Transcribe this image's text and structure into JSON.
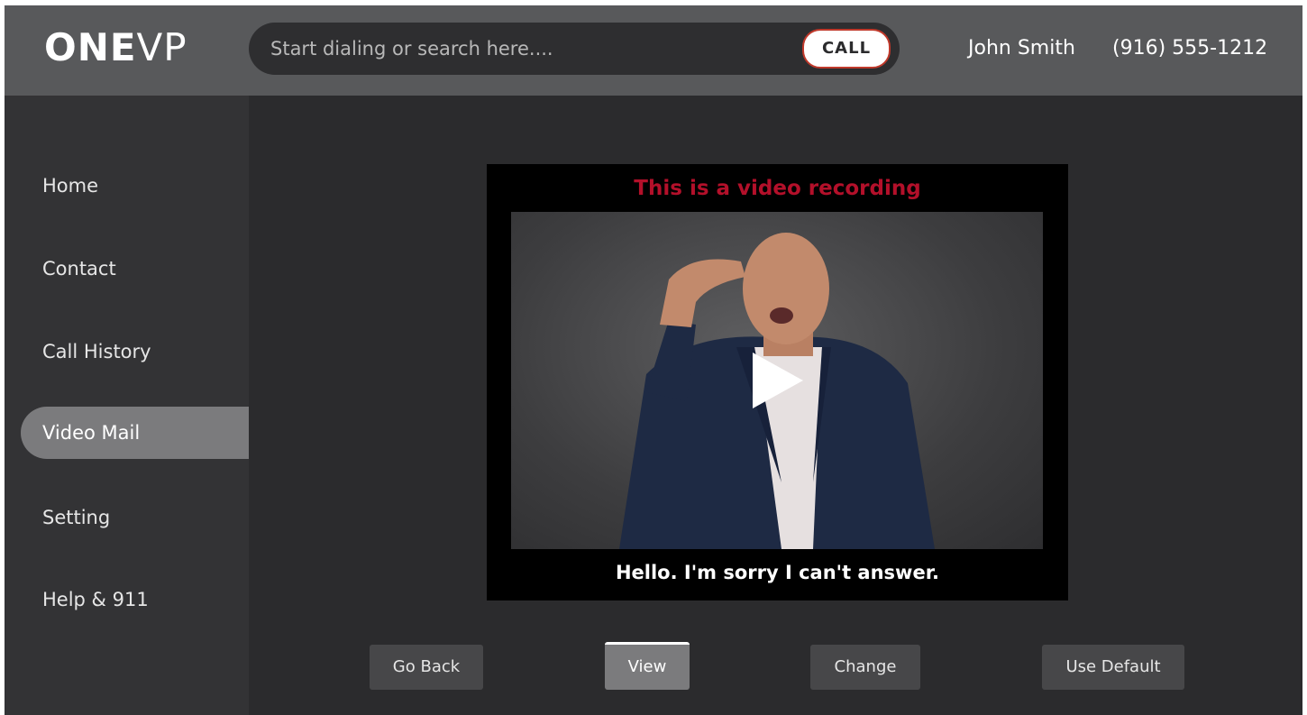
{
  "header": {
    "logo_bold": "ONE",
    "logo_light": "VP",
    "search": {
      "placeholder": "Start dialing or search here....",
      "value": ""
    },
    "call_label": "CALL",
    "user_name": "John Smith",
    "user_phone": "(916) 555-1212"
  },
  "sidebar": {
    "items": [
      {
        "label": "Home",
        "active": false
      },
      {
        "label": "Contact",
        "active": false
      },
      {
        "label": "Call History",
        "active": false
      },
      {
        "label": "Video Mail",
        "active": true
      },
      {
        "label": "Setting",
        "active": false
      },
      {
        "label": "Help & 911",
        "active": false
      }
    ]
  },
  "video": {
    "top_caption": "This is a video recording",
    "bottom_caption": "Hello. I'm sorry I can't answer.",
    "play_icon": "play-icon"
  },
  "actions": {
    "buttons": [
      {
        "label": "Go Back",
        "selected": false
      },
      {
        "label": "View",
        "selected": true
      },
      {
        "label": "Change",
        "selected": false
      },
      {
        "label": "Use Default",
        "selected": false
      }
    ]
  },
  "colors": {
    "header_bg": "#58595b",
    "page_bg": "#2b2b2d",
    "sidebar_bg": "#333335",
    "active_item": "#7b7b7d",
    "call_border": "#c0392b",
    "recording_caption": "#b3102a"
  }
}
